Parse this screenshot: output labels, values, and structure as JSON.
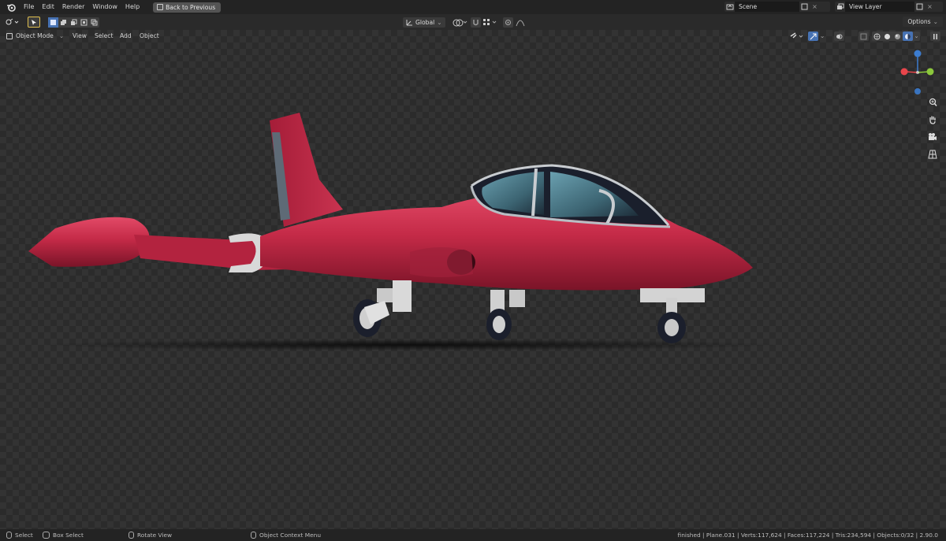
{
  "menu": [
    "File",
    "Edit",
    "Render",
    "Window",
    "Help"
  ],
  "back_button": "Back to Previous",
  "scene": {
    "value": "Scene"
  },
  "view_layer": {
    "value": "View Layer"
  },
  "toolbar": {
    "orientation": "Global",
    "options_label": "Options"
  },
  "header": {
    "mode": "Object Mode",
    "items": [
      "View",
      "Select",
      "Add",
      "Object"
    ]
  },
  "status": {
    "select": "Select",
    "box_select": "Box Select",
    "rotate_view": "Rotate View",
    "context_menu": "Object Context Menu",
    "stats": "finished | Plane.031 | Verts:117,624 | Faces:117,224 | Tris:234,594 | Objects:0/32 | 2.90.0"
  },
  "colors": {
    "accent": "#4772b3",
    "aircraft_body": "#c8304a",
    "axis_x": "#e8454b",
    "axis_y": "#8cc83c",
    "axis_z": "#3c7ccf"
  }
}
